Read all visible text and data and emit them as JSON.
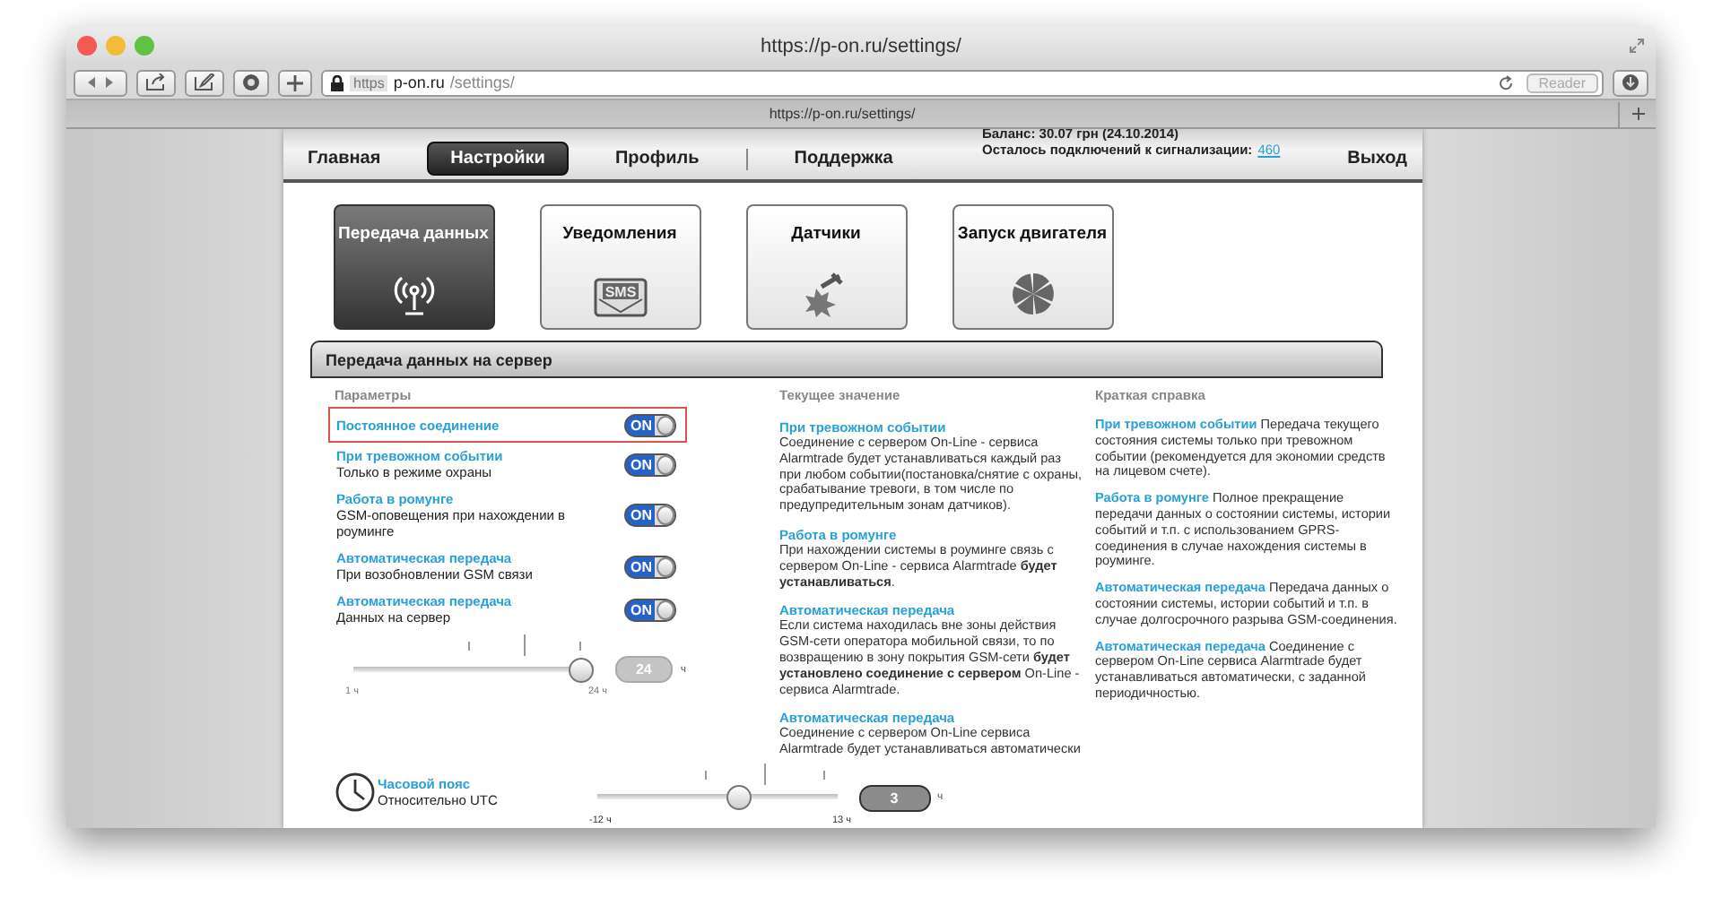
{
  "browser": {
    "title": "https://p-on.ru/settings/",
    "url_scheme": "https",
    "url_host": "p-on.ru",
    "url_path": "/settings/",
    "reader": "Reader",
    "tab_title": "https://p-on.ru/settings/"
  },
  "header": {
    "balance": "Баланс: 30.07 грн (24.10.2014)",
    "connections_label": "Осталось подключений к сигнализации:",
    "connections_count": "460",
    "nav": [
      {
        "label": "Главная",
        "selected": false
      },
      {
        "label": "Настройки",
        "selected": true
      },
      {
        "label": "Профиль",
        "selected": false
      },
      {
        "label": "Поддержка",
        "selected": false
      }
    ],
    "logout": "Выход"
  },
  "tiles": [
    {
      "label": "Передача данных",
      "selected": true,
      "kind": "antenna"
    },
    {
      "label": "Уведомления",
      "selected": false,
      "kind": "sms",
      "icon_text": "SMS"
    },
    {
      "label": "Датчики",
      "selected": false,
      "kind": "sensor"
    },
    {
      "label": "Запуск двигателя",
      "selected": false,
      "kind": "fan"
    }
  ],
  "section": {
    "title": "Передача данных на сервер",
    "params_heading": "Параметры",
    "current_heading": "Текущее значение",
    "help_heading": "Краткая справка"
  },
  "params": [
    {
      "title": "Постоянное соединение",
      "on": true,
      "selected": true,
      "toggle_text": "ON"
    },
    {
      "title": "При тревожном событии",
      "subtitle": "Только в режиме охраны",
      "on": true,
      "selected": false,
      "toggle_text": "ON"
    },
    {
      "title": "Работа в ромунге",
      "subtitle": "GSM-оповещения при нахождении в роуминге",
      "on": true,
      "selected": false,
      "toggle_text": "ON"
    },
    {
      "title": "Автоматическая передача",
      "subtitle": "При возобновлении GSM связи",
      "on": true,
      "selected": false,
      "toggle_text": "ON"
    },
    {
      "title": "Автоматическая передача",
      "subtitle": "Данных на сервер",
      "on": true,
      "selected": false,
      "toggle_text": "ON"
    }
  ],
  "interval": {
    "level": 1,
    "value": "24",
    "unit": "ч",
    "min_label": "1 ч",
    "max_label": "24 ч"
  },
  "current": [
    {
      "title": "При тревожном событии",
      "body": "Соединение с сервером On-Line - сервиса Alarmtrade будет устанавливаться каждый раз при любом событии(постановка/снятие с охраны, срабатывание тревоги, в том числе по предупредительным зонам датчиков)."
    },
    {
      "title": "Работа в ромунге",
      "body": "При нахождении системы в роуминге связь с сервером On-Line - сервиса Alarmtrade **будет устанавливаться**."
    },
    {
      "title": "Автоматическая передача",
      "body": "Если система находилась вне зоны действия GSM-сети оператора мобильной связи, то по возвращению в зону покрытия GSM-сети **будет установлено соединение с сервером** On-Line - сервиса Alarmtrade."
    },
    {
      "title": "Автоматическая передача",
      "body": "Соединение с сервером On-Line сервиса Alarmtrade будет устанавливаться автоматически"
    }
  ],
  "help": [
    {
      "title": "При тревожном событии",
      "body": "Передача текущего состояния системы только при тревожном событии (рекомендуется для экономии средств на лицевом счете)."
    },
    {
      "title": "Работа в ромунге",
      "body": "Полное прекращение передачи данных о состоянии системы, истории событий и т.п. с использованием GPRS-соединения в случае нахождения системы в роуминге."
    },
    {
      "title": "Автоматическая передача",
      "body": "Передача данных о состоянии системы, истории событий и т.п. в случае долгосрочного разрыва GSM-соединения."
    },
    {
      "title": "Автоматическая передача",
      "body": "Соединение с сервером On-Line сервиса Alarmtrade будет устанавливаться автоматически, с заданной периодичностью."
    }
  ],
  "timezone": {
    "title": "Часовой пояс",
    "subtitle": "Относительно UTC",
    "level": 0.6,
    "value": "3",
    "unit": "ч",
    "min_label": "-12 ч",
    "max_label": "13 ч"
  }
}
